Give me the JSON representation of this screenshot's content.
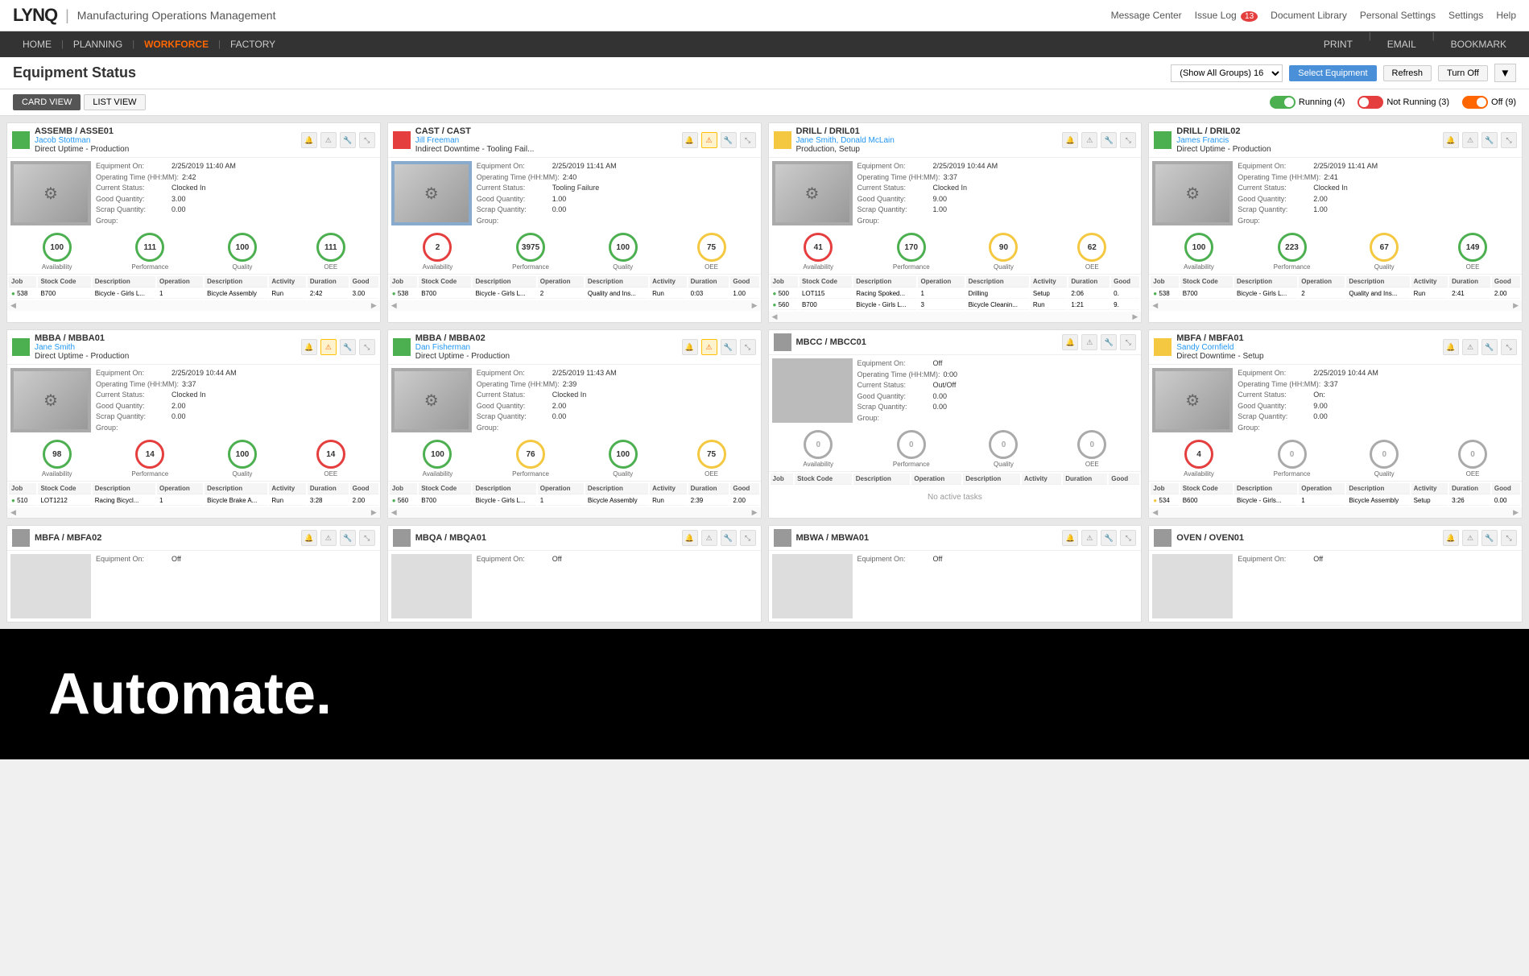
{
  "app": {
    "logo": "LYNQ",
    "title": "Manufacturing Operations Management"
  },
  "topLinks": {
    "messageCenter": "Message Center",
    "issueLog": "Issue Log",
    "issueCount": "13",
    "documentLibrary": "Document Library",
    "personalSettings": "Personal Settings",
    "settings": "Settings",
    "help": "Help"
  },
  "nav": {
    "items": [
      "HOME",
      "PLANNING",
      "WORKFORCE",
      "FACTORY"
    ],
    "activeItem": "WORKFORCE",
    "rightItems": [
      "PRINT",
      "EMAIL",
      "BOOKMARK"
    ]
  },
  "pageHeader": {
    "title": "Equipment Status",
    "groupsLabel": "(Show All Groups) 16",
    "selectEquipmentBtn": "Select Equipment",
    "refreshBtn": "Refresh",
    "turnOffBtn": "Turn Off"
  },
  "viewToggle": {
    "cardView": "CARD VIEW",
    "listView": "LIST VIEW",
    "running": "Running (4)",
    "notRunning": "Not Running (3)",
    "off": "Off (9)"
  },
  "cards": [
    {
      "id": "assemb-asse01",
      "status": "green",
      "name": "ASSEMB / ASSE01",
      "operator": "Jacob Stottman",
      "mode": "Direct Uptime - Production",
      "equipmentOn": "2/25/2019 11:40 AM",
      "operatingTime": "2:42",
      "currentStatus": "Clocked In",
      "goodQty": "3.00",
      "scrapQty": "0.00",
      "group": "",
      "availability": "100",
      "performance": "111",
      "quality": "100",
      "oee": "111",
      "availCircle": "green",
      "perfCircle": "green",
      "qualCircle": "green",
      "oeeCircle": "green",
      "tableRows": [
        {
          "dot": "green",
          "job": "538",
          "stockCode": "B700",
          "desc": "Bicycle - Girls L...",
          "operation": "1",
          "opDesc": "Bicycle Assembly",
          "activity": "Run",
          "duration": "2:42",
          "good": "3.00"
        }
      ]
    },
    {
      "id": "cast-cast",
      "status": "red",
      "name": "CAST / CAST",
      "operator": "Jill Freeman",
      "mode": "Indirect Downtime - Tooling Fail...",
      "equipmentOn": "2/25/2019 11:41 AM",
      "operatingTime": "2:40",
      "currentStatus": "Tooling Failure",
      "goodQty": "1.00",
      "scrapQty": "0.00",
      "group": "",
      "availability": "2",
      "performance": "3975",
      "quality": "100",
      "oee": "75",
      "availCircle": "red",
      "perfCircle": "green",
      "qualCircle": "green",
      "oeeCircle": "yellow",
      "tableRows": [
        {
          "dot": "green",
          "job": "538",
          "stockCode": "B700",
          "desc": "Bicycle - Girls L...",
          "operation": "2",
          "opDesc": "Quality and Ins...",
          "activity": "Run",
          "duration": "0:03",
          "good": "1.00"
        }
      ]
    },
    {
      "id": "drill-dril01",
      "status": "yellow",
      "name": "DRILL / DRIL01",
      "operator": "Jane Smith, Donald McLain",
      "mode": "Production, Setup",
      "equipmentOn": "2/25/2019 10:44 AM",
      "operatingTime": "3:37",
      "currentStatus": "Clocked In",
      "goodQty": "9.00",
      "scrapQty": "1.00",
      "group": "",
      "availability": "41",
      "performance": "170",
      "quality": "90",
      "oee": "62",
      "availCircle": "red",
      "perfCircle": "green",
      "qualCircle": "yellow",
      "oeeCircle": "yellow",
      "tableRows": [
        {
          "dot": "green",
          "job": "500",
          "stockCode": "LOT115",
          "desc": "Racing Spoked...",
          "operation": "1",
          "opDesc": "Drilling",
          "activity": "Setup",
          "duration": "2:06",
          "good": "0."
        },
        {
          "dot": "green",
          "job": "560",
          "stockCode": "B700",
          "desc": "Bicycle - Girls L...",
          "operation": "3",
          "opDesc": "Bicycle Cleanin...",
          "activity": "Run",
          "duration": "1:21",
          "good": "9."
        }
      ]
    },
    {
      "id": "drill-dril02",
      "status": "green",
      "name": "DRILL / DRIL02",
      "operator": "James Francis",
      "mode": "Direct Uptime - Production",
      "equipmentOn": "2/25/2019 11:41 AM",
      "operatingTime": "2:41",
      "currentStatus": "Clocked In",
      "goodQty": "2.00",
      "scrapQty": "1.00",
      "group": "",
      "availability": "100",
      "performance": "223",
      "quality": "67",
      "oee": "149",
      "availCircle": "green",
      "perfCircle": "green",
      "qualCircle": "yellow",
      "oeeCircle": "green",
      "tableRows": [
        {
          "dot": "green",
          "job": "538",
          "stockCode": "B700",
          "desc": "Bicycle - Girls L...",
          "operation": "2",
          "opDesc": "Quality and Ins...",
          "activity": "Run",
          "duration": "2:41",
          "good": "2.00"
        }
      ]
    },
    {
      "id": "mbba-mbba01",
      "status": "green",
      "name": "MBBA / MBBA01",
      "operator": "Jane Smith",
      "mode": "Direct Uptime - Production",
      "equipmentOn": "2/25/2019 10:44 AM",
      "operatingTime": "3:37",
      "currentStatus": "Clocked In",
      "goodQty": "2.00",
      "scrapQty": "0.00",
      "group": "",
      "availability": "98",
      "performance": "14",
      "quality": "100",
      "oee": "14",
      "availCircle": "green",
      "perfCircle": "red",
      "qualCircle": "green",
      "oeeCircle": "red",
      "tableRows": [
        {
          "dot": "green",
          "job": "510",
          "stockCode": "LOT1212",
          "desc": "Racing Bicycl...",
          "operation": "1",
          "opDesc": "Bicycle Brake A...",
          "activity": "Run",
          "duration": "3:28",
          "good": "2.00"
        }
      ]
    },
    {
      "id": "mbba-mbba02",
      "status": "green",
      "name": "MBBA / MBBA02",
      "operator": "Dan Fisherman",
      "mode": "Direct Uptime - Production",
      "equipmentOn": "2/25/2019 11:43 AM",
      "operatingTime": "2:39",
      "currentStatus": "Clocked In",
      "goodQty": "2.00",
      "scrapQty": "0.00",
      "group": "",
      "availability": "100",
      "performance": "76",
      "quality": "100",
      "oee": "75",
      "availCircle": "green",
      "perfCircle": "yellow",
      "qualCircle": "green",
      "oeeCircle": "yellow",
      "tableRows": [
        {
          "dot": "green",
          "job": "560",
          "stockCode": "B700",
          "desc": "Bicycle - Girls L...",
          "operation": "1",
          "opDesc": "Bicycle Assembly",
          "activity": "Run",
          "duration": "2:39",
          "good": "2.00"
        }
      ]
    },
    {
      "id": "mbcc-mbcc01",
      "status": "gray",
      "name": "MBCC / MBCC01",
      "operator": "",
      "mode": "",
      "equipmentOn": "Off",
      "operatingTime": "0:00",
      "currentStatus": "Out/Off",
      "goodQty": "0.00",
      "scrapQty": "0.00",
      "group": "",
      "availability": "0",
      "performance": "0",
      "quality": "0",
      "oee": "0",
      "availCircle": "gray",
      "perfCircle": "gray",
      "qualCircle": "gray",
      "oeeCircle": "gray",
      "tableRows": [],
      "noTasks": "No active tasks"
    },
    {
      "id": "mbfa-mbfa01",
      "status": "yellow",
      "name": "MBFA / MBFA01",
      "operator": "Sandy Cornfield",
      "mode": "Direct Downtime - Setup",
      "equipmentOn": "2/25/2019 10:44 AM",
      "operatingTime": "3:37",
      "currentStatus": "On:",
      "goodQty": "9.00",
      "scrapQty": "0.00",
      "group": "",
      "availability": "4",
      "performance": "0",
      "quality": "0",
      "oee": "0",
      "availCircle": "red",
      "perfCircle": "gray",
      "qualCircle": "gray",
      "oeeCircle": "gray",
      "tableRows": [
        {
          "dot": "yellow",
          "job": "534",
          "stockCode": "B600",
          "desc": "Bicycle - Girls...",
          "operation": "1",
          "opDesc": "Bicycle Assembly",
          "activity": "Setup",
          "duration": "3:26",
          "good": "0.00"
        }
      ]
    },
    {
      "id": "mbfa-mbfa02",
      "status": "gray",
      "name": "MBFA / MBFA02",
      "operator": "",
      "mode": "",
      "equipmentOn": "Off",
      "operatingTime": "",
      "currentStatus": "",
      "goodQty": "",
      "scrapQty": "",
      "group": "",
      "availability": "",
      "performance": "",
      "quality": "",
      "oee": "",
      "availCircle": "gray",
      "perfCircle": "gray",
      "qualCircle": "gray",
      "oeeCircle": "gray",
      "tableRows": [],
      "partial": true
    },
    {
      "id": "mbqa-mbqa01",
      "status": "gray",
      "name": "MBQA / MBQA01",
      "operator": "",
      "mode": "",
      "equipmentOn": "Off",
      "operatingTime": "",
      "currentStatus": "",
      "goodQty": "",
      "scrapQty": "",
      "group": "",
      "availability": "",
      "performance": "",
      "quality": "",
      "oee": "",
      "availCircle": "gray",
      "perfCircle": "gray",
      "qualCircle": "gray",
      "oeeCircle": "gray",
      "tableRows": [],
      "partial": true
    },
    {
      "id": "mbwa-mbwa01",
      "status": "gray",
      "name": "MBWA / MBWA01",
      "operator": "",
      "mode": "",
      "equipmentOn": "Off",
      "operatingTime": "",
      "currentStatus": "",
      "goodQty": "",
      "scrapQty": "",
      "group": "",
      "availability": "",
      "performance": "",
      "quality": "",
      "oee": "",
      "availCircle": "gray",
      "perfCircle": "gray",
      "qualCircle": "gray",
      "oeeCircle": "gray",
      "tableRows": [],
      "partial": true
    },
    {
      "id": "oven-oven01",
      "status": "gray",
      "name": "OVEN / OVEN01",
      "operator": "",
      "mode": "",
      "equipmentOn": "Off",
      "operatingTime": "",
      "currentStatus": "",
      "goodQty": "",
      "scrapQty": "",
      "group": "",
      "availability": "",
      "performance": "",
      "quality": "",
      "oee": "",
      "availCircle": "gray",
      "perfCircle": "gray",
      "qualCircle": "gray",
      "oeeCircle": "gray",
      "tableRows": [],
      "partial": true
    }
  ],
  "tableHeaders": [
    "Job",
    "Stock Code",
    "Description",
    "Operation",
    "Description",
    "Activity",
    "Duration",
    "Good"
  ],
  "metricLabels": [
    "Availability",
    "Performance",
    "Quality",
    "OEE"
  ],
  "automate": {
    "text": "Automate."
  }
}
